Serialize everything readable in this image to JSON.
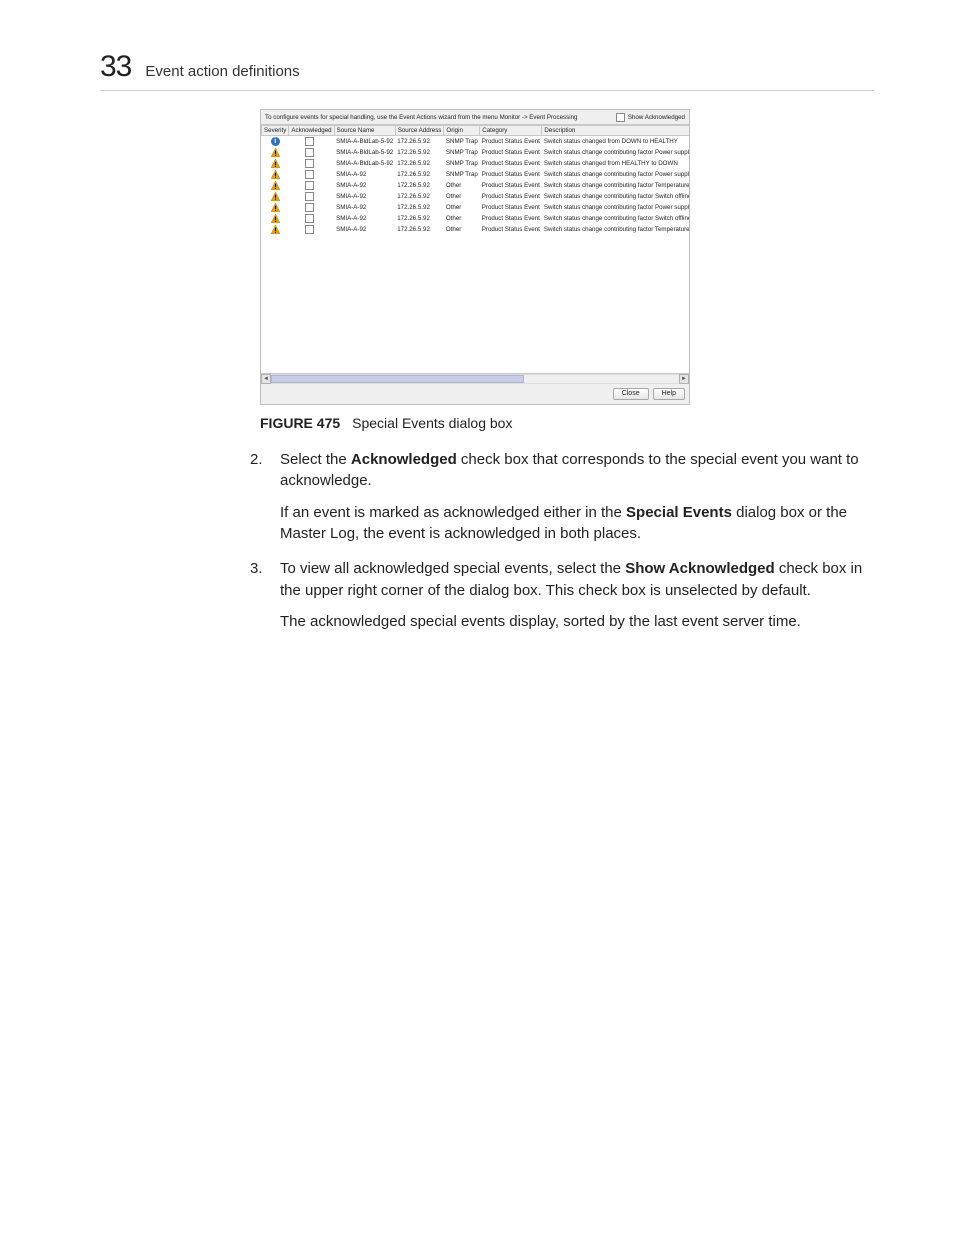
{
  "header": {
    "chapter_number": "33",
    "chapter_title": "Event action definitions"
  },
  "dialog": {
    "intro": "To configure events for special handling, use the Event Actions wizard from the menu Monitor -> Event Processing",
    "show_ack_label": "Show Acknowledged",
    "columns": [
      "Severity",
      "Acknowledged",
      "Source Name",
      "Source Address",
      "Origin",
      "Category",
      "Description"
    ],
    "rows": [
      {
        "sev": "info",
        "src": "SMIA-A-BldLab-5-92",
        "addr": "172.26.5.92",
        "origin": "SNMP Trap",
        "cat": "Product Status Event",
        "desc": "Switch status changed from DOWN to HEALTHY"
      },
      {
        "sev": "warn",
        "src": "SMIA-A-BldLab-5-92",
        "addr": "172.26.5.92",
        "origin": "SNMP Trap",
        "cat": "Product Status Event",
        "desc": "Switch status change contributing factor Power supply"
      },
      {
        "sev": "warn",
        "src": "SMIA-A-BldLab-5-92",
        "addr": "172.26.5.92",
        "origin": "SNMP Trap",
        "cat": "Product Status Event",
        "desc": "Switch status changed from HEALTHY to DOWN"
      },
      {
        "sev": "warn",
        "src": "SMIA-A-92",
        "addr": "172.26.5.92",
        "origin": "SNMP Trap",
        "cat": "Product Status Event",
        "desc": "Switch status change contributing factor Power supply"
      },
      {
        "sev": "warn",
        "src": "SMIA-A-92",
        "addr": "172.26.5.92",
        "origin": "Other",
        "cat": "Product Status Event",
        "desc": "Switch status change contributing factor Temperature se"
      },
      {
        "sev": "warn",
        "src": "SMIA-A-92",
        "addr": "172.26.5.92",
        "origin": "Other",
        "cat": "Product Status Event",
        "desc": "Switch status change contributing factor Switch offline"
      },
      {
        "sev": "warn",
        "src": "SMIA-A-92",
        "addr": "172.26.5.92",
        "origin": "Other",
        "cat": "Product Status Event",
        "desc": "Switch status change contributing factor Power supply"
      },
      {
        "sev": "warn",
        "src": "SMIA-A-92",
        "addr": "172.26.5.92",
        "origin": "Other",
        "cat": "Product Status Event",
        "desc": "Switch status change contributing factor Switch offline"
      },
      {
        "sev": "warn",
        "src": "SMIA-A-92",
        "addr": "172.26.5.92",
        "origin": "Other",
        "cat": "Product Status Event",
        "desc": "Switch status change contributing factor Temperature se"
      }
    ],
    "buttons": {
      "close": "Close",
      "help": "Help"
    }
  },
  "caption": {
    "label": "FIGURE 475",
    "text": "Special Events dialog box"
  },
  "steps": {
    "s2": {
      "num": "2.",
      "t1a": "Select the ",
      "t1b": "Acknowledged",
      "t1c": " check box that corresponds to the special event you want to acknowledge.",
      "t2a": "If an event is marked as acknowledged either in the ",
      "t2b": "Special Events",
      "t2c": " dialog box or the Master Log, the event is acknowledged in both places."
    },
    "s3": {
      "num": "3.",
      "t1a": "To view all acknowledged special events, select the ",
      "t1b": "Show Acknowledged",
      "t1c": " check box in the upper right corner of the dialog box. This check box is unselected by default.",
      "t2": "The acknowledged special events display, sorted by the last event server time."
    }
  }
}
